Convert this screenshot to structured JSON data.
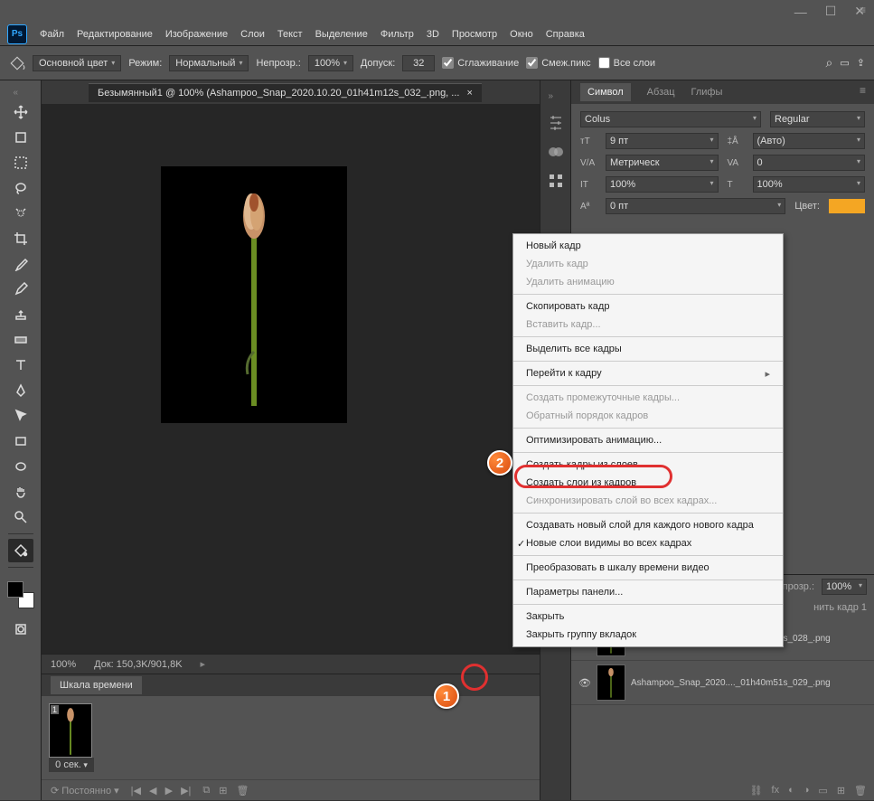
{
  "menu": {
    "items": [
      "Файл",
      "Редактирование",
      "Изображение",
      "Слои",
      "Текст",
      "Выделение",
      "Фильтр",
      "3D",
      "Просмотр",
      "Окно",
      "Справка"
    ]
  },
  "options": {
    "color_label": "Основной цвет",
    "mode_label": "Режим:",
    "mode_value": "Нормальный",
    "opacity_label": "Непрозр.:",
    "opacity_value": "100%",
    "tolerance_label": "Допуск:",
    "tolerance_value": "32",
    "antialias": "Сглаживание",
    "contiguous": "Смеж.пикс",
    "all_layers": "Все слои"
  },
  "doc": {
    "tab_title": "Безымянный1 @ 100% (Ashampoo_Snap_2020.10.20_01h41m12s_032_.png, ...",
    "zoom": "100%",
    "doc_size": "Док: 150,3K/901,8K"
  },
  "timeline": {
    "title": "Шкала времени",
    "frame_time": "0 сек.",
    "loop": "Постоянно"
  },
  "char_panel": {
    "tabs": [
      "Символ",
      "Абзац",
      "Глифы"
    ],
    "font": "Colus",
    "style": "Regular",
    "size": "9 пт",
    "leading": "(Авто)",
    "kerning": "Метрическ",
    "tracking": "0",
    "vscale": "100%",
    "hscale": "100%",
    "baseline": "0 пт",
    "color_label": "Цвет:"
  },
  "layers": {
    "opacity_label": "Непрозр.:",
    "opacity": "100%",
    "fill_label": "нить кадр 1",
    "items": [
      {
        "name": "Ashampoo_Snap_2020...._01h40m41s_028_.png"
      },
      {
        "name": "Ashampoo_Snap_2020...._01h40m51s_029_.png"
      }
    ]
  },
  "context": {
    "items": [
      {
        "label": "Новый кадр"
      },
      {
        "label": "Удалить кадр",
        "disabled": true
      },
      {
        "label": "Удалить анимацию",
        "disabled": true
      },
      {
        "sep": true
      },
      {
        "label": "Скопировать кадр"
      },
      {
        "label": "Вставить кадр...",
        "disabled": true
      },
      {
        "sep": true
      },
      {
        "label": "Выделить все кадры"
      },
      {
        "sep": true
      },
      {
        "label": "Перейти к кадру",
        "sub": true
      },
      {
        "sep": true
      },
      {
        "label": "Создать промежуточные кадры...",
        "disabled": true
      },
      {
        "label": "Обратный порядок кадров",
        "disabled": true
      },
      {
        "sep": true
      },
      {
        "label": "Оптимизировать анимацию..."
      },
      {
        "sep": true
      },
      {
        "label": "Создать кадры из слоев",
        "highlighted": true
      },
      {
        "label": "Создать слои из кадров"
      },
      {
        "label": "Синхронизировать слой во всех кадрах...",
        "disabled": true
      },
      {
        "sep": true
      },
      {
        "label": "Создавать новый слой для каждого нового кадра"
      },
      {
        "label": "Новые слои видимы во всех кадрах",
        "check": true
      },
      {
        "sep": true
      },
      {
        "label": "Преобразовать в шкалу времени видео"
      },
      {
        "sep": true
      },
      {
        "label": "Параметры панели..."
      },
      {
        "sep": true
      },
      {
        "label": "Закрыть"
      },
      {
        "label": "Закрыть группу вкладок"
      }
    ]
  },
  "markers": {
    "one": "1",
    "two": "2"
  }
}
